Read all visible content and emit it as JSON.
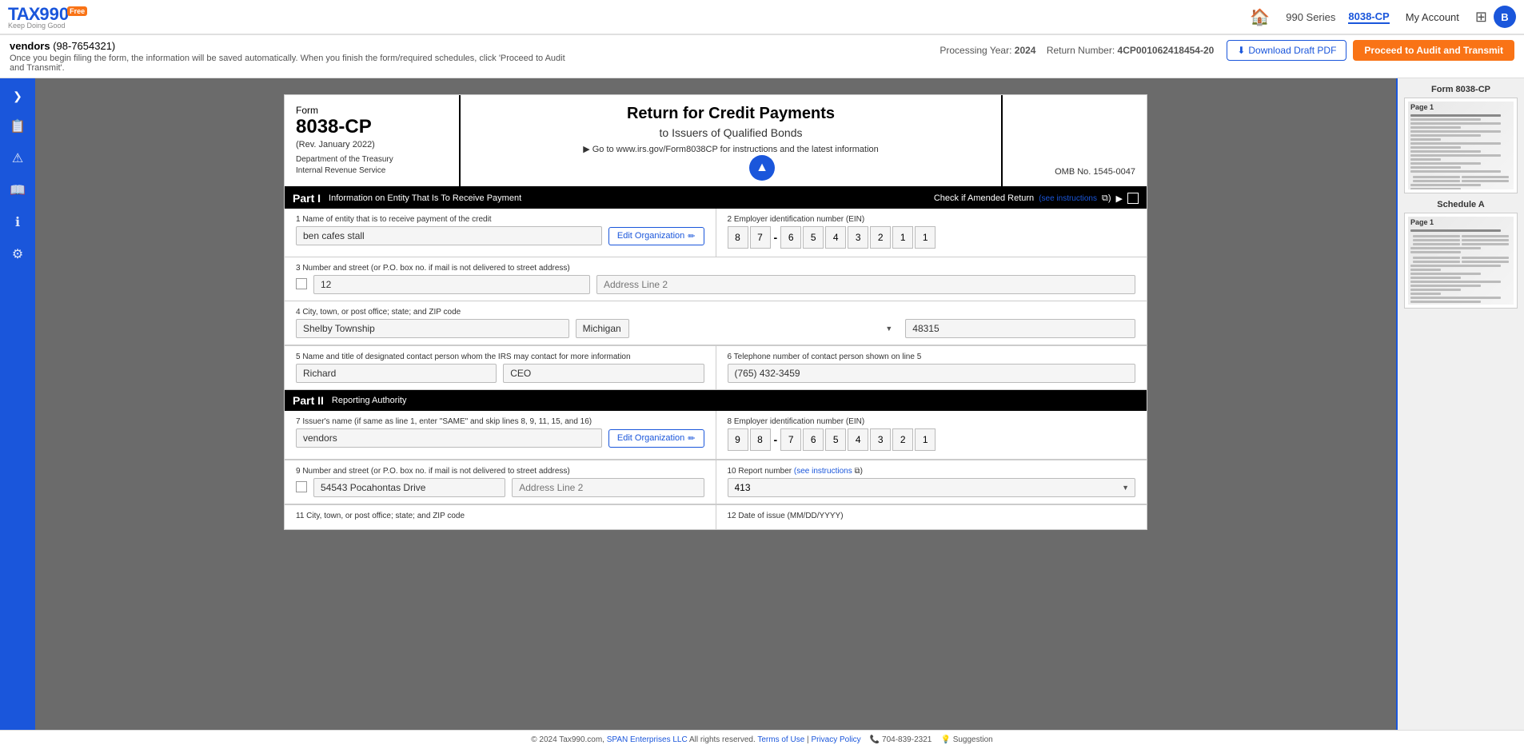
{
  "app": {
    "logo_tax": "TAX",
    "logo_990": "990",
    "logo_badge": "Free",
    "logo_tagline": "Keep Doing Good",
    "nav_series": "990 Series",
    "nav_current": "8038-CP",
    "nav_myaccount": "My Account",
    "nav_user_initial": "B"
  },
  "subheader": {
    "title": "vendors",
    "ein": "(98-7654321)",
    "description": "Once you begin filing the form, the information will be saved automatically. When you finish the form/required schedules, click 'Proceed to Audit and Transmit'.",
    "processing_year_label": "Processing Year:",
    "processing_year": "2024",
    "return_number_label": "Return Number:",
    "return_number": "4CP001062418454-20",
    "btn_draft": "Download Draft PDF",
    "btn_proceed": "Proceed to Audit and Transmit"
  },
  "form": {
    "form_label": "Form",
    "form_number": "8038-CP",
    "rev": "(Rev. January 2022)",
    "dept1": "Department of the Treasury",
    "dept2": "Internal Revenue Service",
    "title": "Return for Credit Payments",
    "subtitle": "to Issuers of Qualified Bonds",
    "instruction_arrow": "▶",
    "instruction_text": "Go to www.irs.gov/Form8038CP for instructions and the latest information",
    "omb": "OMB No. 1545-0047",
    "part1_label": "Part I",
    "part1_desc": "Information on Entity That Is To Receive Payment",
    "amended_text": "Check if Amended Return",
    "amended_see": "(see instructions",
    "field1_label": "1 Name of entity that is to receive payment of the credit",
    "field1_value": "ben cafes stall",
    "edit_org_btn": "Edit Organization",
    "field2_label": "2 Employer identification number (EIN)",
    "field2_ein": [
      "8",
      "7",
      "-",
      "6",
      "5",
      "4",
      "3",
      "2",
      "1",
      "1"
    ],
    "field3_label": "3 Number and street (or P.O. box no. if mail is not delivered to street address)",
    "field3_value": "12",
    "field3_addr2_placeholder": "Address Line 2",
    "field4_label": "4 City, town, or post office; state; and ZIP code",
    "field4_city": "Shelby Township",
    "field4_state": "Michigan",
    "field4_zip": "48315",
    "field5_label": "5 Name and title of designated contact person whom the IRS may contact for more information",
    "field5_first": "Richard",
    "field5_title": "CEO",
    "field6_label": "6 Telephone number of contact person shown on line 5",
    "field6_phone": "(765) 432-3459",
    "part2_label": "Part II",
    "part2_desc": "Reporting Authority",
    "field7_label": "7 Issuer's name (if same as line 1, enter \"SAME\" and skip lines 8, 9, 11, 15, and 16)",
    "field7_value": "vendors",
    "field8_label": "8 Employer identification number (EIN)",
    "field8_ein": [
      "9",
      "8",
      "-",
      "7",
      "6",
      "5",
      "4",
      "3",
      "2",
      "1"
    ],
    "field9_label": "9 Number and street (or P.O. box no. if mail is not delivered to street address)",
    "field9_value": "54543 Pocahontas Drive",
    "field9_addr2_placeholder": "Address Line 2",
    "field10_label": "10 Report number",
    "field10_see": "(see instructions",
    "field10_value": "413",
    "field11_label": "11 City, town, or post office; state; and ZIP code",
    "field12_label": "12 Date of issue (MM/DD/YYYY)"
  },
  "right_sidebar": {
    "form_thumb_label": "Form 8038-CP",
    "page1_label": "Page 1",
    "schedule_label": "Schedule A",
    "sched_page1_label": "Page 1"
  },
  "footer": {
    "copyright": "© 2024 Tax990.com,",
    "span_link": "SPAN Enterprises LLC",
    "rights": "All rights reserved.",
    "terms": "Terms of Use",
    "privacy": "Privacy Policy",
    "phone_icon": "📞",
    "phone": "704-839-2321",
    "suggestion_icon": "💡",
    "suggestion": "Suggestion"
  },
  "scroll_up_icon": "▲",
  "sidebar_icons": {
    "arrow": "❯",
    "copy": "📋",
    "warning": "⚠",
    "book": "📖",
    "info": "ℹ",
    "settings": "⚙"
  }
}
